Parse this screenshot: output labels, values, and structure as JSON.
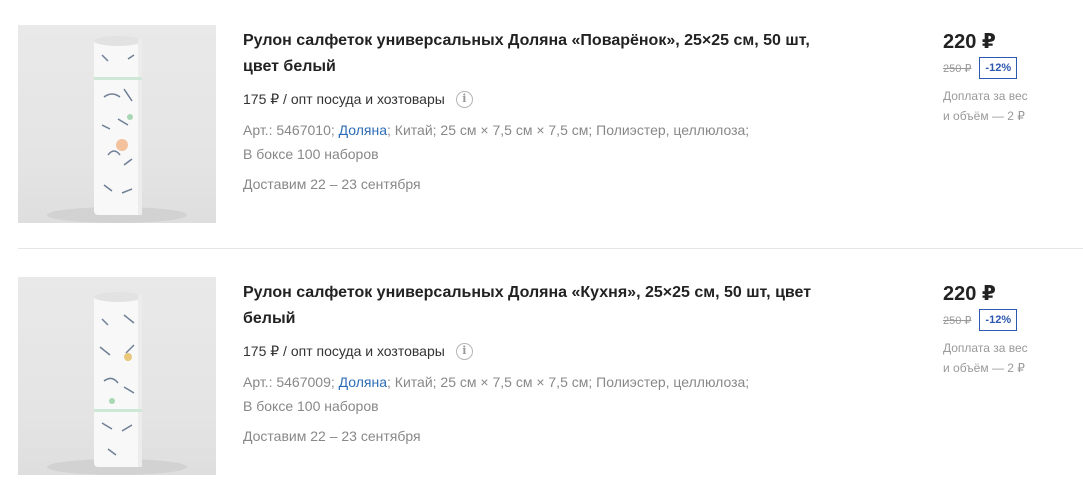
{
  "products": [
    {
      "image_alt": "paper-towel-roll-image",
      "title": "Рулон салфеток универсальных Доляна «Поварёнок», 25×25 см, 50 шт, цвет белый",
      "opt_price": "175 ₽ / опт посуда и хозтовары",
      "info_icon_glyph": "i",
      "art": "Арт.: 5467010;",
      "brand": "Доляна",
      "specs": "; Китай; 25 см × 7,5 см × 7,5 см; Полиэстер, целлюлоза;",
      "box": "В боксе 100 наборов",
      "delivery": "Доставим 22 – 23 сентября",
      "price": "220 ₽",
      "old_price": "250 ₽",
      "discount": "-12%",
      "extra_line1": "Доплата за вес",
      "extra_line2": "и объём — 2 ₽"
    },
    {
      "image_alt": "paper-towel-roll-image",
      "title": "Рулон салфеток универсальных Доляна «Кухня», 25×25 см, 50 шт, цвет белый",
      "opt_price": "175 ₽ / опт посуда и хозтовары",
      "info_icon_glyph": "i",
      "art": "Арт.: 5467009;",
      "brand": "Доляна",
      "specs": "; Китай; 25 см × 7,5 см × 7,5 см; Полиэстер, целлюлоза;",
      "box": "В боксе 100 наборов",
      "delivery": "Доставим 22 – 23 сентября",
      "price": "220 ₽",
      "old_price": "250 ₽",
      "discount": "-12%",
      "extra_line1": "Доплата за вес",
      "extra_line2": "и объём — 2 ₽"
    }
  ],
  "colors": {
    "brand_link": "#2d6cb5",
    "discount": "#2d58b0",
    "muted": "#888888"
  }
}
